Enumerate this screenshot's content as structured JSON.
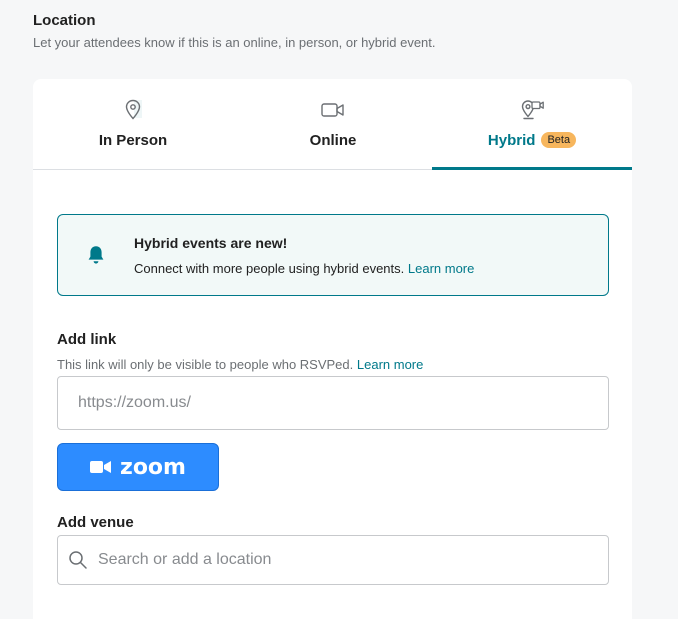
{
  "section": {
    "title": "Location",
    "subtitle": "Let your attendees know if this is an online, in person, or hybrid event."
  },
  "tabs": [
    {
      "label": "In Person",
      "icon": "map-pin-icon",
      "active": false
    },
    {
      "label": "Online",
      "icon": "video-camera-icon",
      "active": false
    },
    {
      "label": "Hybrid",
      "icon": "hybrid-location-video-icon",
      "active": true,
      "badge": "Beta"
    }
  ],
  "banner": {
    "icon": "bell-icon",
    "title": "Hybrid events are new!",
    "text": "Connect with more people using hybrid events.",
    "link": "Learn more"
  },
  "add_link": {
    "label": "Add link",
    "help": "This link will only be visible to people who RSVPed.",
    "help_link": "Learn more",
    "placeholder": "https://zoom.us/",
    "value": ""
  },
  "zoom_button": {
    "label": "zoom",
    "icon": "zoom-camera-icon"
  },
  "venue": {
    "label": "Add venue",
    "placeholder": "Search or add a location",
    "icon": "search-icon"
  },
  "colors": {
    "accent": "#00798a",
    "badge": "#f7b65d",
    "zoom_blue": "#2d8cff",
    "banner_bg": "#f2f9f8",
    "page_bg": "#f6f7f8"
  }
}
